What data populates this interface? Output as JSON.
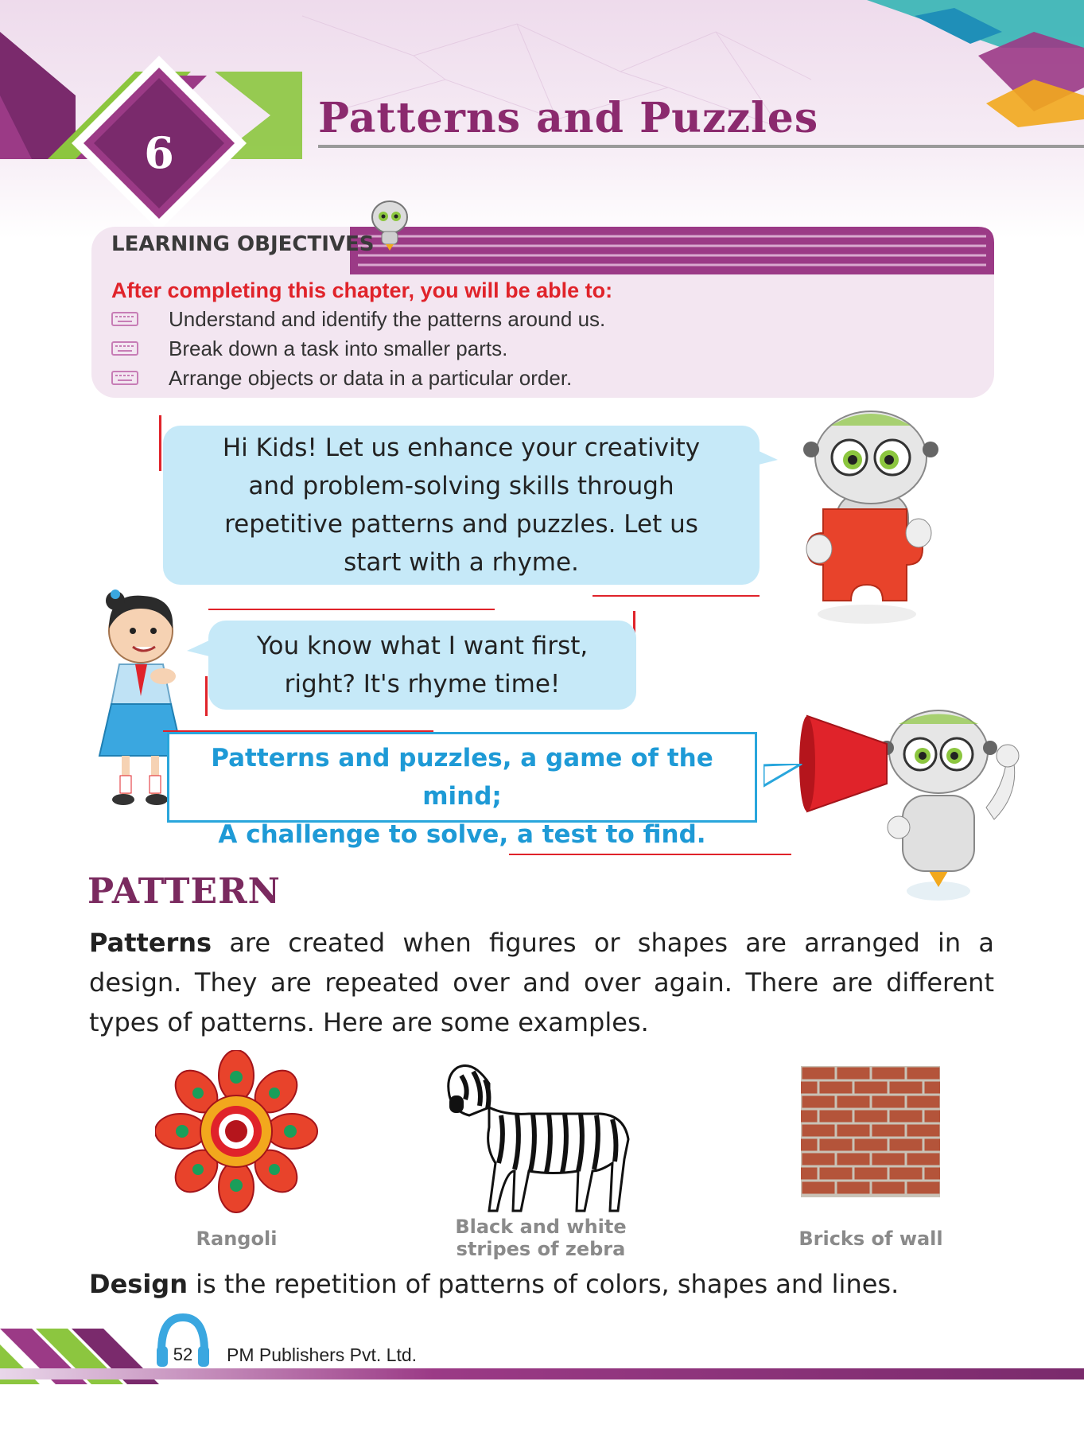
{
  "chapter": {
    "number": "6",
    "title": "Patterns and Puzzles"
  },
  "learning_objectives": {
    "heading": "LEARNING OBJECTIVES",
    "intro": "After completing this chapter, you will be able to:",
    "items": [
      "Understand and identify the patterns around us.",
      "Break down a task into smaller parts.",
      "Arrange objects or data in a particular order."
    ]
  },
  "dialogue": {
    "robot_lines": [
      "Hi Kids! Let us enhance your creativity",
      "and problem-solving skills through",
      "repetitive patterns and puzzles. Let us",
      "start with a rhyme."
    ],
    "girl_lines": [
      "You know what I want first,",
      "right? It's rhyme time!"
    ],
    "rhyme_lines": [
      "Patterns and puzzles, a game of the mind;",
      "A challenge to solve, a test to find."
    ]
  },
  "section": {
    "heading": "PATTERN",
    "term": "Patterns",
    "paragraph": " are created when figures or shapes are arranged in a design. They are repeated over and over again. There are different types of patterns. Here are some examples."
  },
  "examples": [
    {
      "caption_lines": [
        "Rangoli"
      ]
    },
    {
      "caption_lines": [
        "Black and white",
        "stripes of zebra"
      ]
    },
    {
      "caption_lines": [
        "Bricks of wall"
      ]
    }
  ],
  "design_definition": {
    "term": "Design",
    "text": " is the repetition of patterns of colors, shapes and lines."
  },
  "footer": {
    "page_number": "52",
    "publisher": "PM Publishers Pvt. Ltd."
  },
  "colors": {
    "accent_purple": "#8b2a6e",
    "accent_green": "#8cc63f",
    "bubble_blue": "#c6e9f8",
    "rhyme_blue": "#1e9ad6",
    "objective_red": "#e0232a"
  }
}
